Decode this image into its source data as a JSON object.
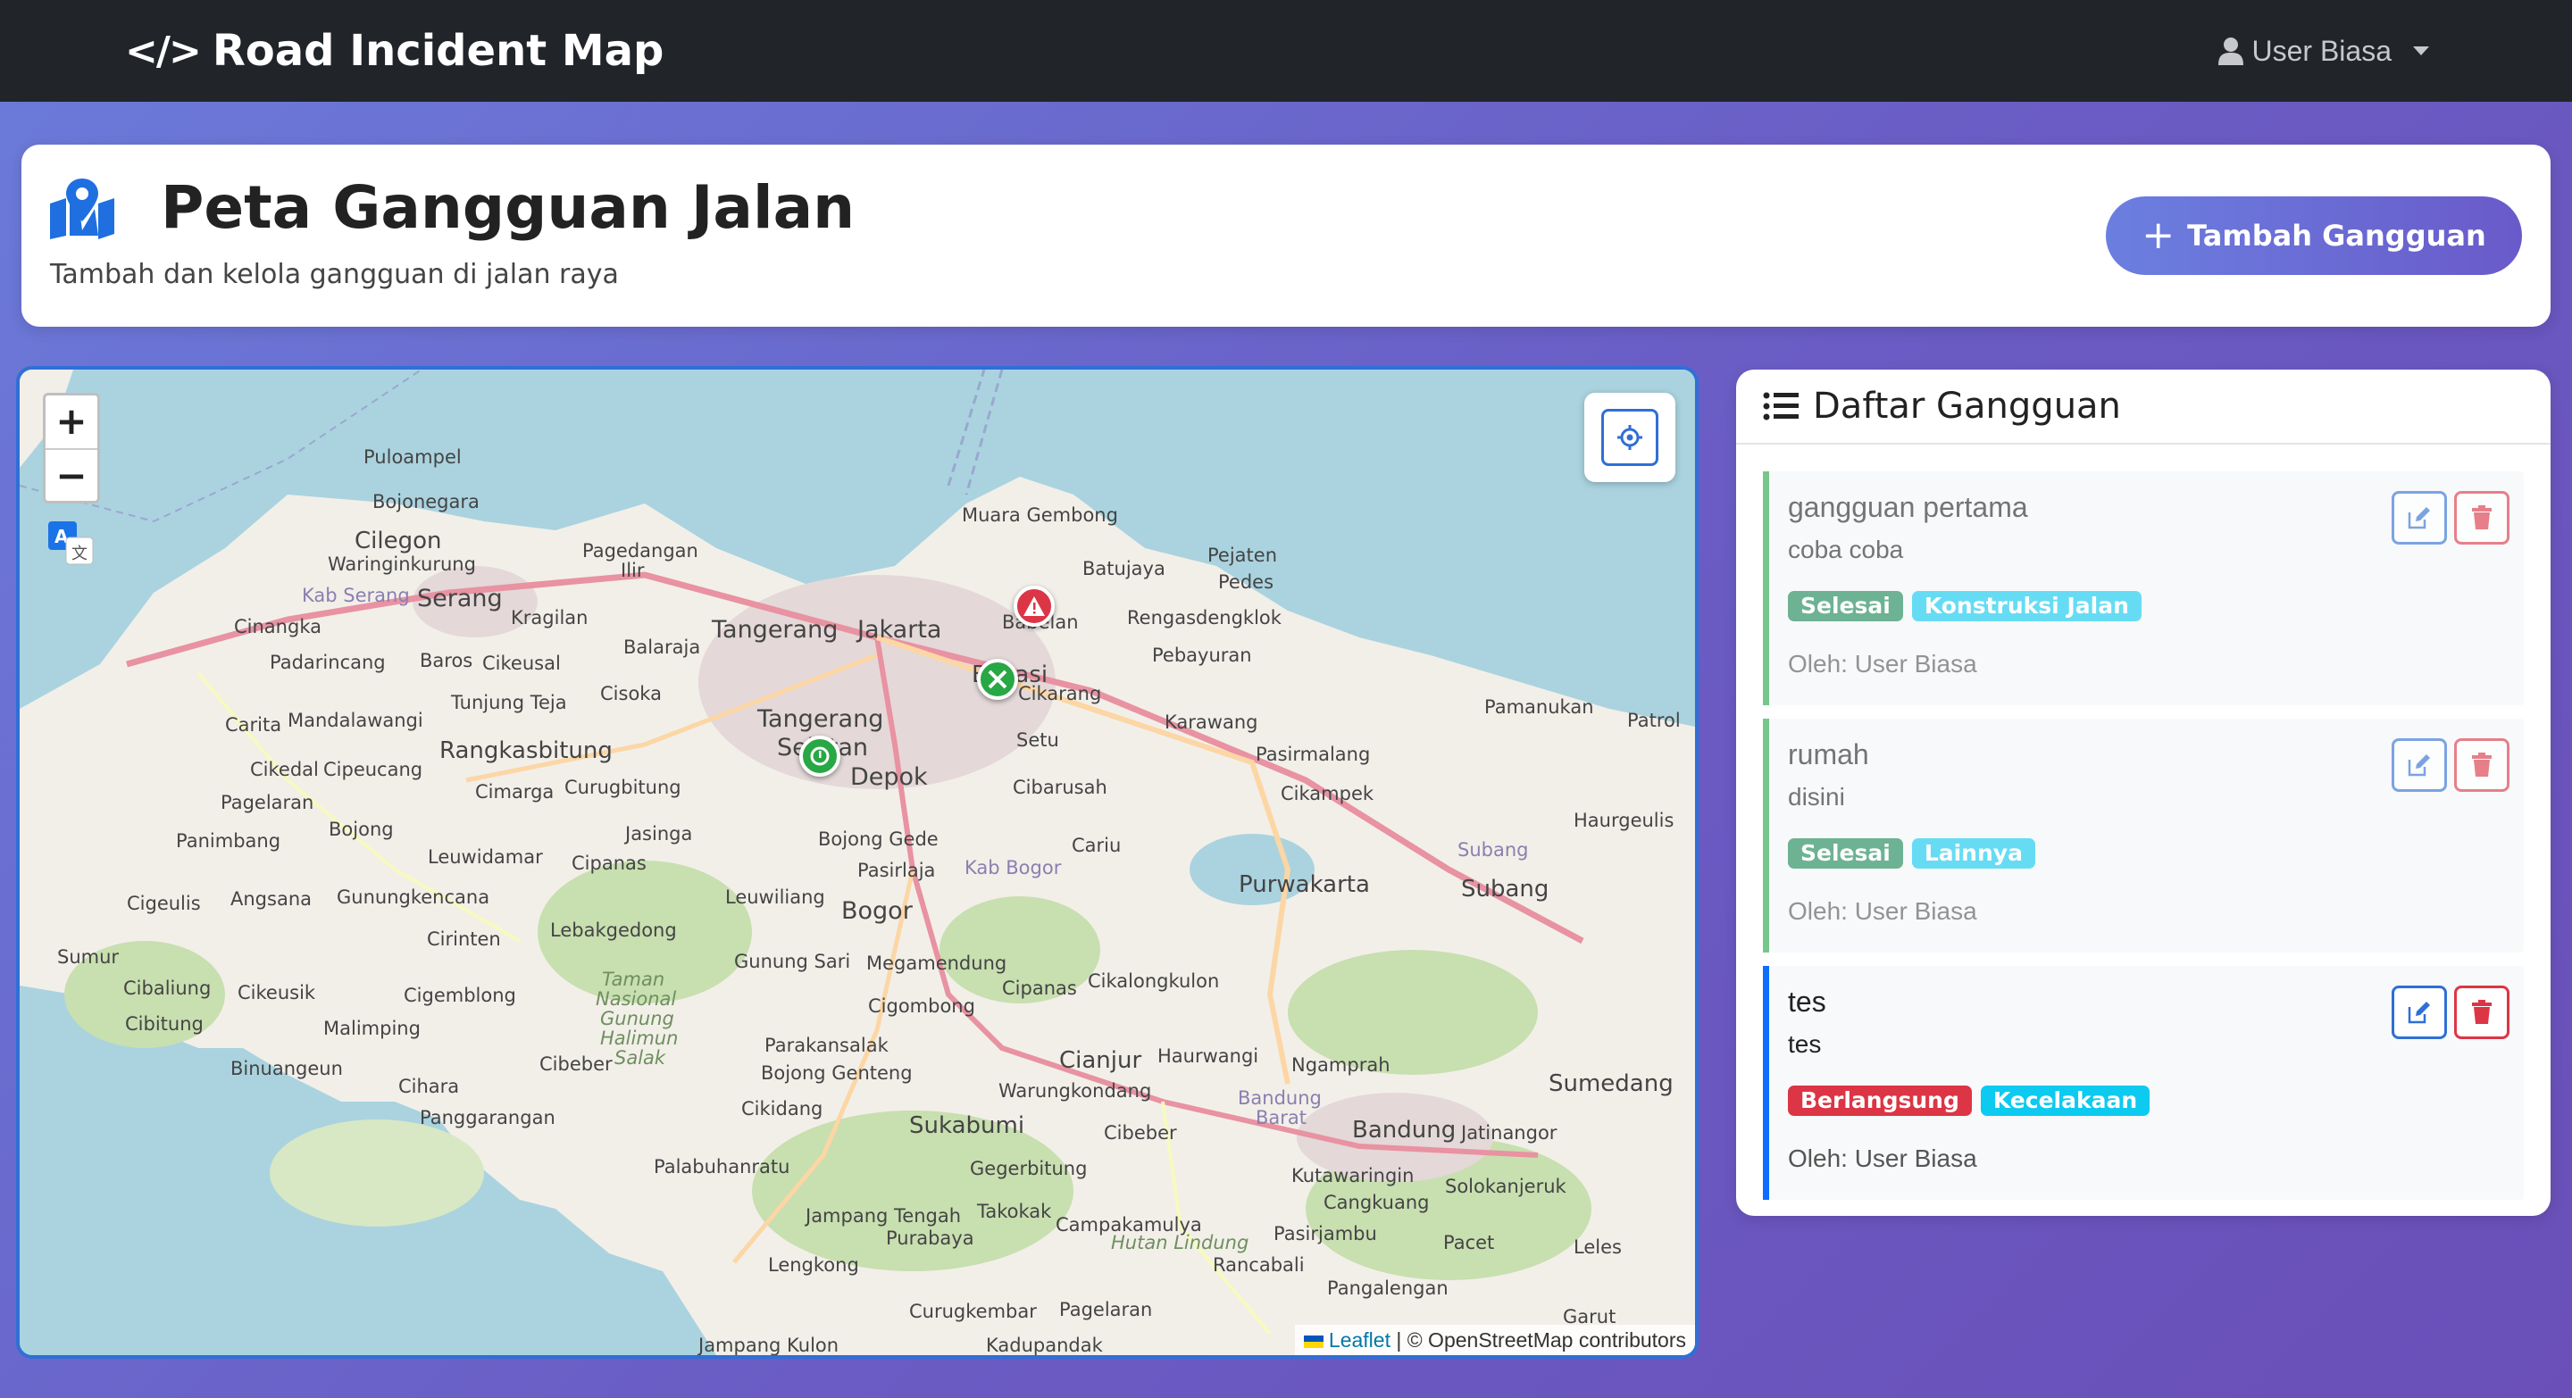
{
  "navbar": {
    "brand_icon": "</>",
    "brand": "Road Incident Map",
    "user": "User Biasa"
  },
  "header": {
    "title": "Peta Gangguan Jalan",
    "subtitle": "Tambah dan kelola gangguan di jalan raya",
    "add_button": "Tambah Gangguan"
  },
  "map": {
    "zoom_in": "+",
    "zoom_out": "−",
    "attribution_link": "Leaflet",
    "attribution_text": "| © OpenStreetMap contributors",
    "labels": [
      "Puloampel",
      "Bojonegara",
      "Cilegon",
      "Waringinkurung",
      "Pagedangan Ilir",
      "Kab Serang",
      "Serang",
      "Kragilan",
      "Cinangka",
      "Padarincang",
      "Baros",
      "Cikeusal",
      "Balaraja",
      "Tangerang",
      "Jakarta",
      "Muara Gembong",
      "Batujaya",
      "Pejaten",
      "Pedes",
      "Babelan",
      "Rengasdengklok",
      "Pebayuran",
      "Tunjung Teja",
      "Cisoka",
      "Bekasi",
      "Cikarang",
      "Karawang",
      "Pamanukan",
      "Patrol",
      "Carita",
      "Mandalawangi",
      "Rangkasbitung",
      "Tangerang Selatan",
      "Setu",
      "Pasirmalang",
      "Cikedal",
      "Cipeucang",
      "Cimarga",
      "Curugbitung",
      "Depok",
      "Cibarusah",
      "Cikampek",
      "Haurgeulis",
      "Pagelaran",
      "Bojong",
      "Jasinga",
      "Bojong Gede",
      "Cariu",
      "Subang",
      "Panimbang",
      "Leuwidamar",
      "Cipanas",
      "Pasirlaja",
      "Kab Bogor",
      "Purwakarta",
      "Cigeulis",
      "Angsana",
      "Gunungkencana",
      "Leuwiliang",
      "Bogor",
      "Cirinten",
      "Lebakgedong",
      "Sumur",
      "Cibaliung",
      "Cikeusik",
      "Cigemblong",
      "Gunung Sari",
      "Megamendung",
      "Cipanas",
      "Cikalongkulon",
      "Cibitung",
      "Malimping",
      "Cigombong",
      "Parakansalak",
      "Cianjur",
      "Haurwangi",
      "Ngamprah",
      "Sumedang",
      "Binuangeun",
      "Cihara",
      "Cibeber",
      "Bojong Genteng",
      "Warungkondang",
      "Bandung Barat",
      "Panggarangan",
      "Cikidang",
      "Sukabumi",
      "Cibeber",
      "Bandung",
      "Jatinangor",
      "Palabuhanratu",
      "Gegerbitung",
      "Kutawaringin",
      "Solokanjeruk",
      "Cangkuang",
      "Jampang Tengah",
      "Takokak",
      "Campakamulya",
      "Pasirjambu",
      "Purabaya",
      "Hutan Lindung",
      "Pacet",
      "Leles",
      "Lengkong",
      "Rancabali",
      "Pangalengan",
      "Curugkembar",
      "Pagelaran",
      "Garut",
      "Jampang Kulon",
      "Kadupandak",
      "Taman Nasional Gunung Halimun Salak"
    ]
  },
  "list": {
    "title": "Daftar Gangguan",
    "items": [
      {
        "title": "gangguan pertama",
        "description": "coba coba",
        "status": "Selesai",
        "category": "Konstruksi Jalan",
        "by": "Oleh: User Biasa",
        "bar_color": "#28a745"
      },
      {
        "title": "rumah",
        "description": "disini",
        "status": "Selesai",
        "category": "Lainnya",
        "by": "Oleh: User Biasa",
        "bar_color": "#28a745"
      },
      {
        "title": "tes",
        "description": "tes",
        "status": "Berlangsung",
        "category": "Kecelakaan",
        "by": "Oleh: User Biasa",
        "bar_color": "#0d6efd"
      }
    ]
  },
  "colors": {
    "success": "#198754",
    "info": "#0dcaf0",
    "danger": "#dc3545",
    "primary": "#0d6efd"
  },
  "icons": [
    "code-icon",
    "user-icon",
    "map-marked-icon",
    "plus-icon",
    "locate-icon",
    "translate-icon",
    "list-icon",
    "edit-icon",
    "trash-icon"
  ]
}
